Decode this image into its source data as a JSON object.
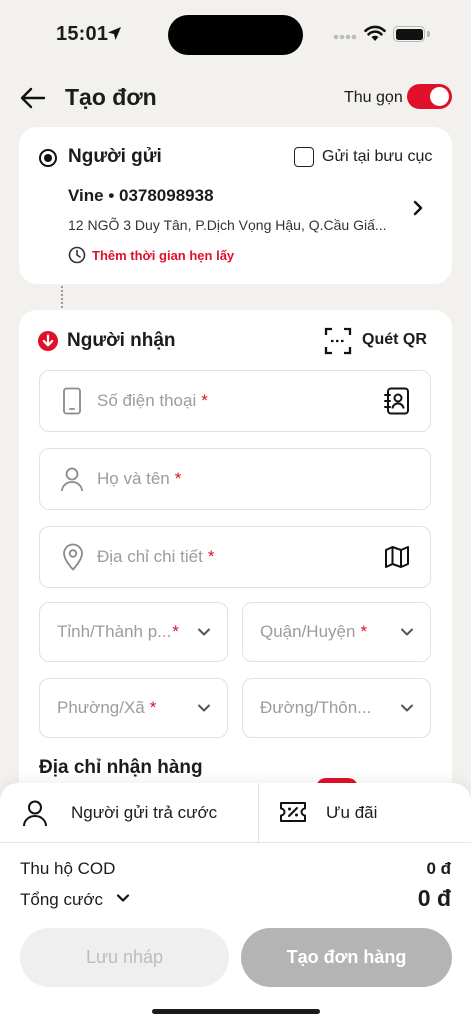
{
  "status_bar": {
    "time": "15:01"
  },
  "header": {
    "title": "Tạo đơn",
    "collapse_label": "Thu gọn",
    "collapse_on": true
  },
  "sender": {
    "title": "Người gửi",
    "post_office_label": "Gửi tại bưu cục",
    "post_office_checked": false,
    "name_phone": "Vine • 0378098938",
    "address": "12 NGÕ 3 Duy Tân, P.Dịch Vọng Hậu, Q.Cầu Giấ...",
    "add_time_link": "Thêm thời gian hẹn lấy"
  },
  "receiver": {
    "title": "Người nhận",
    "scan_qr_label": "Quét QR",
    "required_mark": "*",
    "fields": {
      "phone": "Số điện thoại",
      "full_name": "Họ và tên",
      "address": "Địa chỉ chi tiết",
      "province": "Tỉnh/Thành p...",
      "district": "Quận/Huyện",
      "ward": "Phường/Xã",
      "street": "Đường/Thôn..."
    },
    "delivery_heading": "Địa chỉ nhận hàng"
  },
  "footer": {
    "payer_label": "Người gửi trả cước",
    "promo_label": "Ưu đãi",
    "cod_label": "Thu hộ COD",
    "cod_value": "0 đ",
    "total_label": "Tổng cước",
    "total_value": "0 đ",
    "save_draft_label": "Lưu nháp",
    "create_order_label": "Tạo đơn hàng"
  },
  "colors": {
    "accent": "#e0102a",
    "background": "#f3f1ee",
    "disabled_button": "#b4b4b4"
  },
  "icons": [
    "location-arrow-icon",
    "wifi-icon",
    "back-arrow-icon",
    "chevron-right-icon",
    "clock-icon",
    "arrow-down-circle-icon",
    "qr-scan-icon",
    "phone-icon",
    "contact-book-icon",
    "person-icon",
    "map-pin-icon",
    "map-icon",
    "chevron-down-icon",
    "voucher-icon"
  ]
}
